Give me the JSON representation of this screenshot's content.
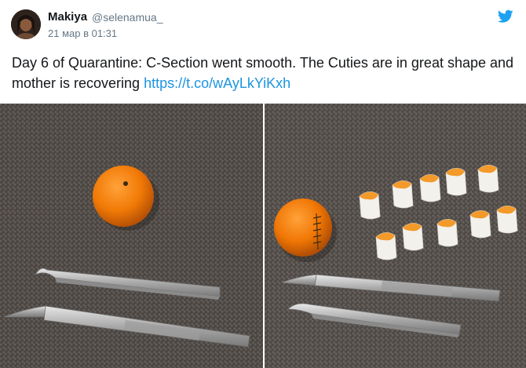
{
  "tweet": {
    "display_name": "Makiya",
    "handle": "@selenamua_",
    "timestamp": "21 мар в 01:31",
    "text": "Day 6 of Quarantine: C-Section went smooth. The Cuties are in great shape and mother is recovering",
    "link_text": "https://t.co/wAyLkYiKxh"
  },
  "icons": {
    "brand": "twitter-bird-icon",
    "brand_color": "#1da1f2"
  },
  "colors": {
    "text": "#14171a",
    "secondary": "#657786",
    "link": "#1b95e0"
  }
}
